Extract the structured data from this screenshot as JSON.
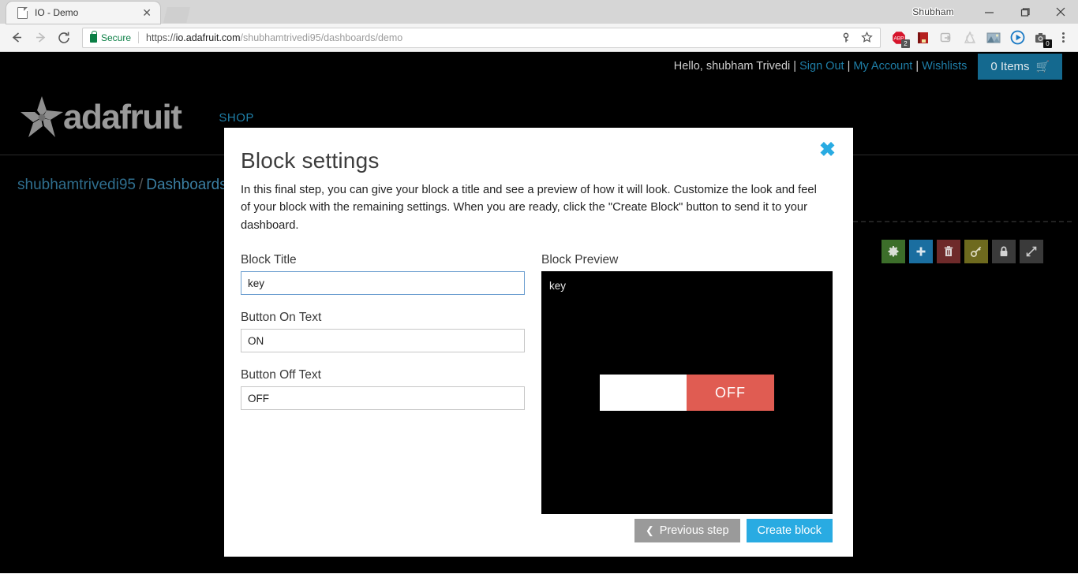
{
  "browser": {
    "tab": {
      "title": "IO - Demo",
      "close_label": "✕"
    },
    "profile_name": "Shubham",
    "window_controls": {
      "minimize": "minimize-icon",
      "maximize": "maximize-icon",
      "close": "close-icon"
    },
    "nav": {
      "back": "back-arrow-icon",
      "forward": "forward-arrow-icon",
      "reload": "reload-icon"
    },
    "omnibox": {
      "secure_label": "Secure",
      "lock_icon": "lock-icon",
      "url_scheme": "https://",
      "url_host": "io.adafruit.com",
      "url_path": "/shubhamtrivedi95/dashboards/demo",
      "key_icon": "key-icon",
      "star_icon": "star-bookmark-icon"
    },
    "extensions": [
      {
        "name": "adblock-plus-icon",
        "badge": "2"
      },
      {
        "name": "red-book-icon",
        "badge": ""
      },
      {
        "name": "share-icon",
        "badge": ""
      },
      {
        "name": "adobe-pdf-icon",
        "badge": ""
      },
      {
        "name": "image-capture-icon",
        "badge": ""
      },
      {
        "name": "media-play-icon",
        "badge": ""
      },
      {
        "name": "camera-icon",
        "badge": "0"
      }
    ],
    "menu_icon": "three-dot-menu-icon"
  },
  "page": {
    "account": {
      "greeting": "Hello, shubham Trivedi",
      "sign_out": "Sign Out",
      "my_account": "My Account",
      "wishlists": "Wishlists",
      "separator": "|",
      "cart_label": "0 Items",
      "cart_icon": "shopping-cart-icon"
    },
    "header": {
      "logo_text": "adafruit",
      "logo_icon": "adafruit-flower-logo",
      "shop_link": "SHOP"
    },
    "breadcrumb": {
      "user": "shubhamtrivedi95",
      "separator": "/",
      "section": "Dashboards"
    },
    "block_toolbar": [
      {
        "name": "settings-gear-button",
        "icon": "gear-icon",
        "color": "#3c6e2a"
      },
      {
        "name": "add-block-button",
        "icon": "plus-icon",
        "color": "#1a6ea0"
      },
      {
        "name": "delete-block-button",
        "icon": "trash-icon",
        "color": "#6e2a2a"
      },
      {
        "name": "key-button",
        "icon": "key-icon",
        "color": "#6e6a1e"
      },
      {
        "name": "lock-button",
        "icon": "lock-icon",
        "color": "#3a3a3a"
      },
      {
        "name": "fullscreen-button",
        "icon": "expand-arrows-icon",
        "color": "#3a3a3a"
      }
    ]
  },
  "modal": {
    "title": "Block settings",
    "close_icon": "✖",
    "description": "In this final step, you can give your block a title and see a preview of how it will look. Customize the look and feel of your block with the remaining settings. When you are ready, click the \"Create Block\" button to send it to your dashboard.",
    "fields": {
      "block_title": {
        "label": "Block Title",
        "value": "key"
      },
      "button_on_text": {
        "label": "Button On Text",
        "value": "ON"
      },
      "button_off_text": {
        "label": "Button Off Text",
        "value": "OFF"
      }
    },
    "preview": {
      "label": "Block Preview",
      "block_title": "key",
      "toggle_state_text": "OFF",
      "toggle_color": "#e05c52"
    },
    "footer": {
      "previous_label": "Previous step",
      "previous_chevron": "❮",
      "create_label": "Create block"
    }
  }
}
